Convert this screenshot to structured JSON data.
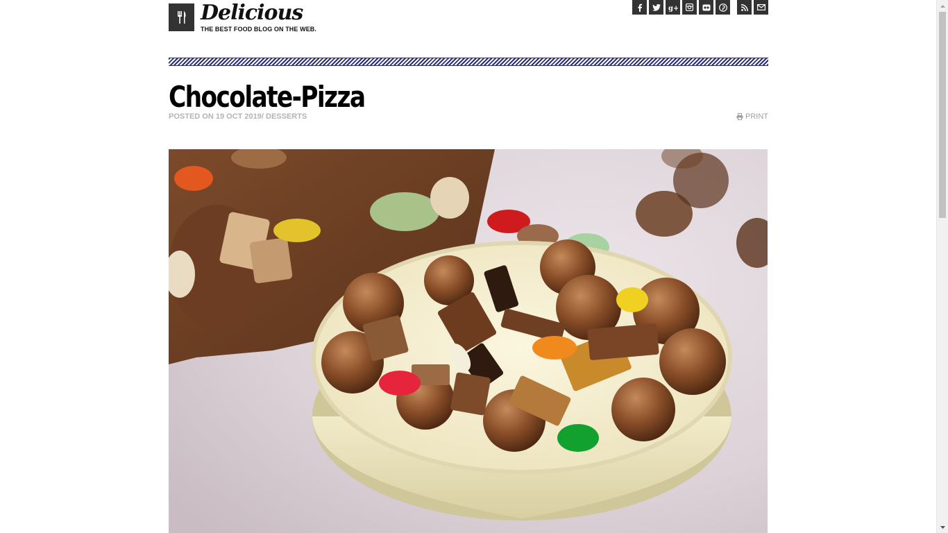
{
  "header": {
    "brand_name": "Delicious",
    "tagline": "THE BEST FOOD BLOG ON THE WEB.",
    "social_icons": [
      "facebook-icon",
      "twitter-icon",
      "google-plus-icon",
      "instagram-icon",
      "flickr-icon",
      "pinterest-icon",
      "rss-icon",
      "email-icon"
    ]
  },
  "post": {
    "title": "Chocolate-Pizza",
    "posted_on_label": "POSTED ON",
    "date": "19 Oct 2019/",
    "category": "DESSERTS",
    "print_label": "PRINT"
  },
  "colors": {
    "header_box": "#333333",
    "stripe": "#2b2f7a",
    "meta_text": "#b3b3b3"
  }
}
